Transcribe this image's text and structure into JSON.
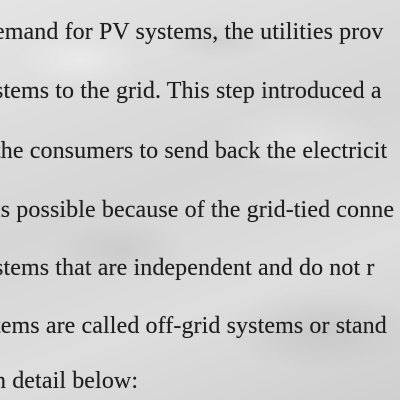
{
  "document": {
    "lines": [
      "emand for PV systems, the utilities prov",
      "stems to the grid. This step introduced a",
      "the consumers to send back the electricit",
      "is possible because of the grid-tied conne",
      "stems that are independent and do not r",
      "tems are called off-grid systems or stand",
      "n detail below:"
    ]
  }
}
